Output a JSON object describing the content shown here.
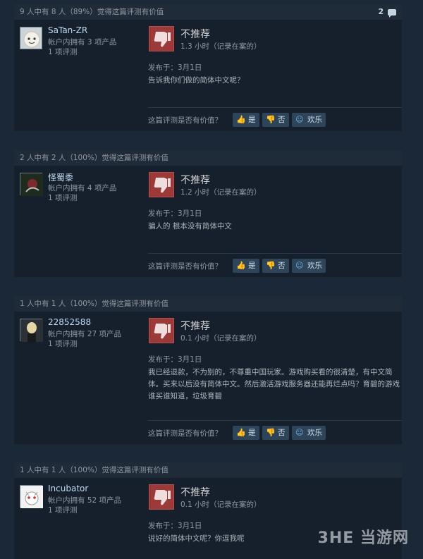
{
  "helpful_question": "这篇评测是否有价值？",
  "vote_labels": {
    "yes": "是",
    "no": "否",
    "funny": "欢乐"
  },
  "rec_label": "不推荐",
  "posted_prefix": "发布于：",
  "watermark": "3HE 当游网",
  "reviews": [
    {
      "helpful_summary": "9 人中有 8 人（89%）觉得这篇评测有价值",
      "comment_count": "2",
      "author": "SaTan-ZR",
      "games": "帐户内拥有 3 项产品",
      "reviews_count": "1 项评测",
      "hours": "1.3 小时（记录在案的）",
      "posted": "3月1日",
      "text": "告诉我你们做的简体中文呢？"
    },
    {
      "helpful_summary": "2 人中有 2 人（100%）觉得这篇评测有价值",
      "author": "怪蜀黍",
      "games": "帐户内拥有 4 项产品",
      "reviews_count": "1 项评测",
      "hours": "1.2 小时（记录在案的）",
      "posted": "3月1日",
      "text": "骗人的 根本没有简体中文"
    },
    {
      "helpful_summary": "1 人中有 1 人（100%）觉得这篇评测有价值",
      "author": "22852588",
      "games": "帐户内拥有 27 项产品",
      "reviews_count": "1 项评测",
      "hours": "0.1 小时（记录在案的）",
      "posted": "3月1日",
      "text": "我已经退款，不为别的，不尊重中国玩家。游戏购买看的很清楚，有中文简体。买来以后没有简体中文。然后激活游戏服务器还能再烂点吗？育碧的游戏谁买谁知道，垃圾育碧"
    },
    {
      "helpful_summary": "1 人中有 1 人（100%）觉得这篇评测有价值",
      "author": "Incubator",
      "games": "帐户内拥有 52 项产品",
      "reviews_count": "1 项评测",
      "hours": "0.1 小时（记录在案的）",
      "posted": "3月1日",
      "text": "说好的简体中文呢？你逗我呢"
    }
  ]
}
